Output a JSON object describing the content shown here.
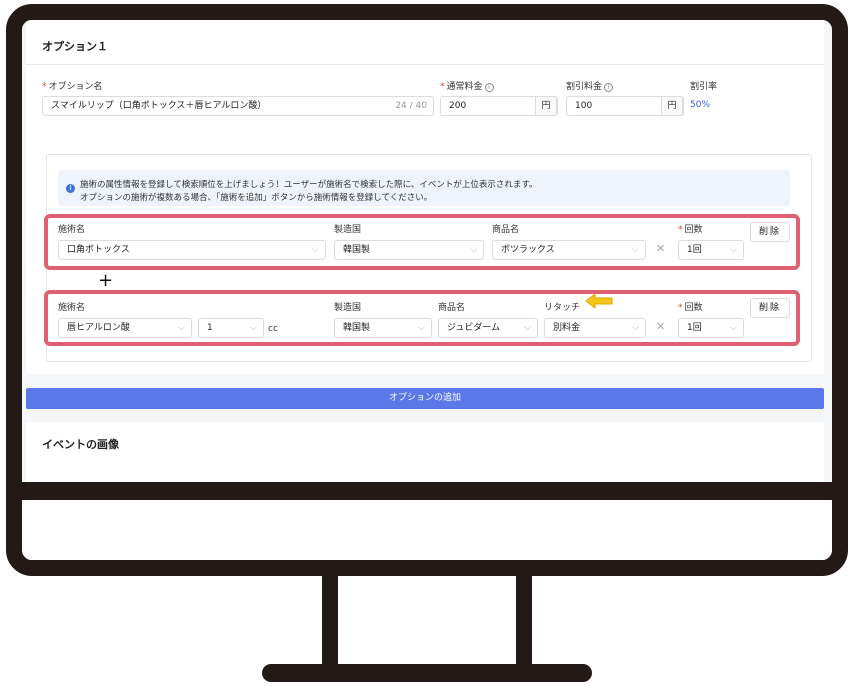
{
  "option": {
    "title": "オプション１",
    "name_label": "オプション名",
    "name_value": "スマイルリップ（口角ボトックス＋唇ヒアルロン酸）",
    "name_count": "24 / 40",
    "normal_price_label": "通常料金",
    "normal_price_value": "200",
    "discount_price_label": "割引料金",
    "discount_price_value": "100",
    "yen": "円",
    "discount_rate_label": "割引率",
    "discount_rate_value": "50%"
  },
  "notice": {
    "line1": "施術の属性情報を登録して検索順位を上げましょう！ユーザーが施術名で検索した際に、イベントが上位表示されます。",
    "line2": "オプションの施術が複数ある場合、「施術を追加」ボタンから施術情報を登録してください。"
  },
  "treatment1": {
    "name_label": "施術名",
    "name_value": "口角ボトックス",
    "country_label": "製造国",
    "country_value": "韓国製",
    "product_label": "商品名",
    "product_value": "ボツラックス",
    "count_label": "回数",
    "count_value": "1回",
    "delete_label": "削除"
  },
  "treatment2": {
    "name_label": "施術名",
    "name_value": "唇ヒアルロン酸",
    "amount_value": "1",
    "unit": "cc",
    "country_label": "製造国",
    "country_value": "韓国製",
    "product_label": "商品名",
    "product_value": "ジュビダーム",
    "retouch_label": "リタッチ",
    "retouch_value": "別料金",
    "count_label": "回数",
    "count_value": "1回",
    "delete_label": "削除"
  },
  "plus_sign": "+",
  "add_option_label": "オプションの追加",
  "event_image_title": "イベントの画像",
  "colors": {
    "highlight": "#e06073",
    "accent": "#5a78e8",
    "arrow": "#f5c518",
    "frame": "#231a17"
  }
}
